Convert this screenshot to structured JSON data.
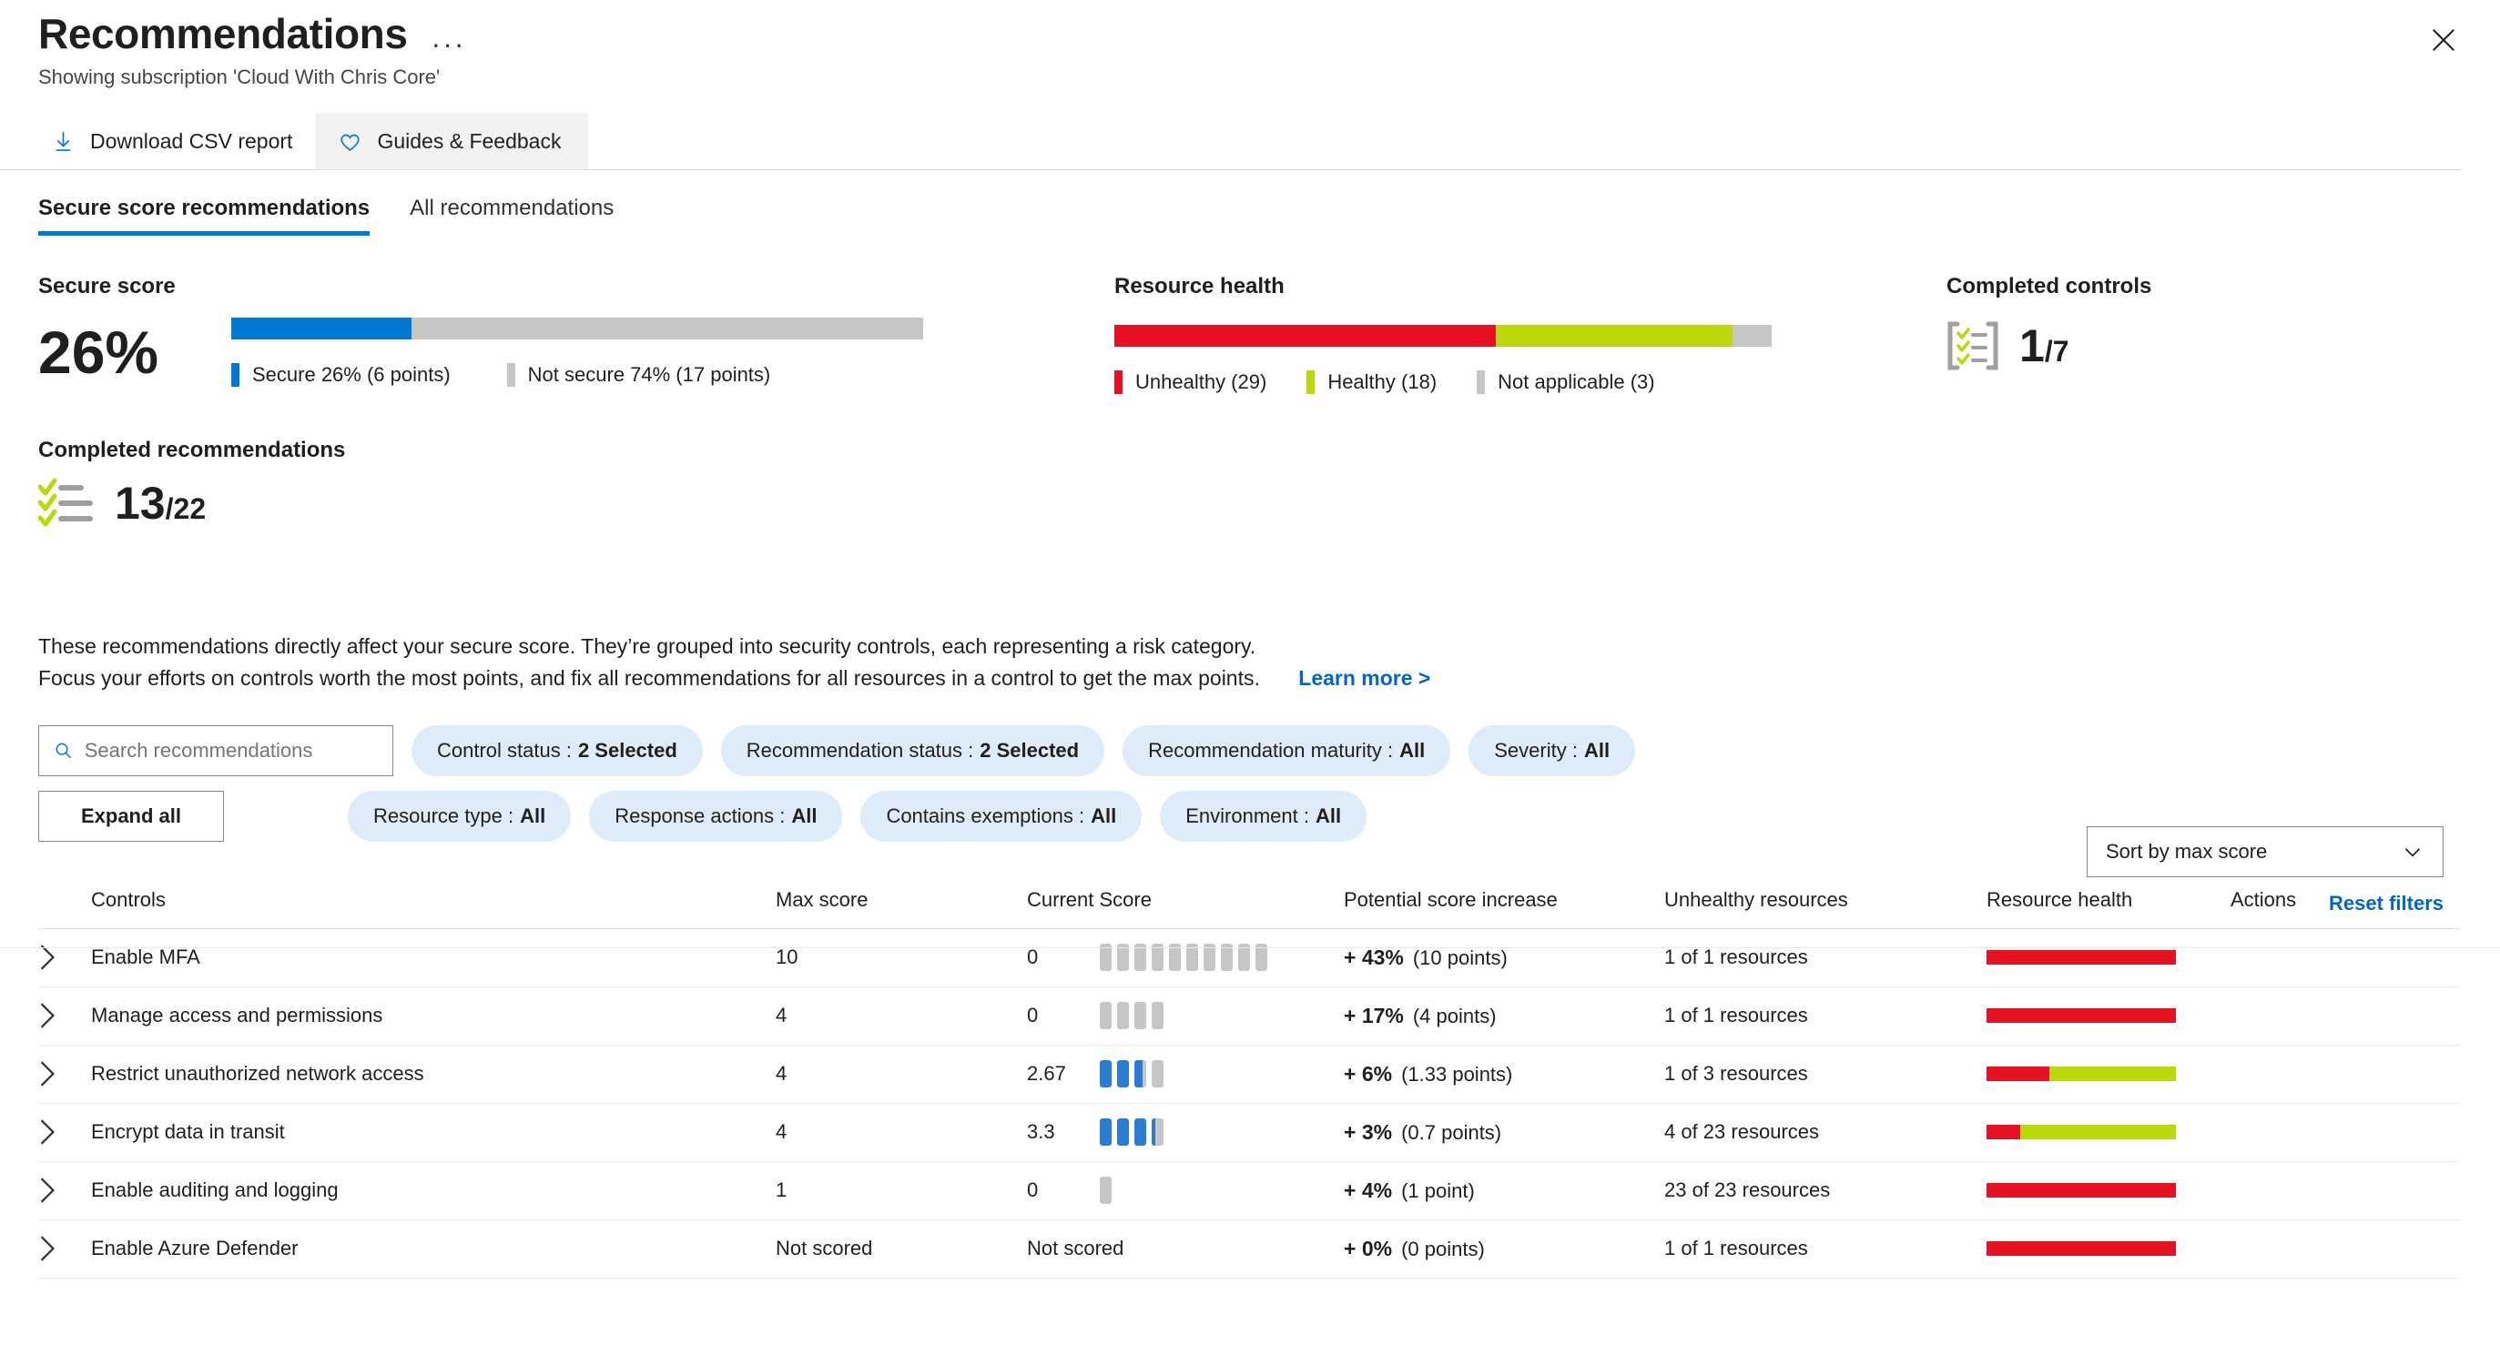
{
  "header": {
    "title": "Recommendations",
    "subtitle": "Showing subscription 'Cloud With Chris Core'",
    "more_label": "···",
    "close_label": ""
  },
  "commandbar": {
    "download_label": "Download CSV report",
    "feedback_label": "Guides & Feedback"
  },
  "tabs": [
    {
      "label": "Secure score recommendations",
      "active": true
    },
    {
      "label": "All recommendations",
      "active": false
    }
  ],
  "summary": {
    "secure_score": {
      "heading": "Secure score",
      "percent_text": "26%",
      "percent": 26,
      "secure_legend": "Secure 26% (6 points)",
      "not_secure_legend": "Not secure 74% (17 points)",
      "secure_color": "#0078d4",
      "not_secure_color": "#c8c6c4"
    },
    "completed_recommendations": {
      "heading": "Completed recommendations",
      "numerator": "13",
      "denominator": "/22"
    },
    "resource_health": {
      "heading": "Resource health",
      "segments": [
        {
          "label": "Unhealthy (29)",
          "value": 29,
          "color": "#e81123"
        },
        {
          "label": "Healthy (18)",
          "value": 18,
          "color": "#bad80a"
        },
        {
          "label": "Not applicable (3)",
          "value": 3,
          "color": "#c8c6c4"
        }
      ]
    },
    "completed_controls": {
      "heading": "Completed controls",
      "numerator": "1",
      "denominator": "/7"
    }
  },
  "description": {
    "line1": "These recommendations directly affect your secure score. They’re grouped into security controls, each representing a risk category.",
    "line2": "Focus your efforts on controls worth the most points, and fix all recommendations for all resources in a control to get the max points.",
    "learn_more": "Learn more >"
  },
  "filters": {
    "search_placeholder": "Search recommendations",
    "expand_all_label": "Expand all",
    "sort_label": "Sort by max score",
    "reset_label": "Reset filters",
    "row1": [
      {
        "name": "Control status",
        "value": "2 Selected"
      },
      {
        "name": "Recommendation status",
        "value": "2 Selected"
      },
      {
        "name": "Recommendation maturity",
        "value": "All"
      },
      {
        "name": "Severity",
        "value": "All"
      }
    ],
    "row2": [
      {
        "name": "Resource type",
        "value": "All"
      },
      {
        "name": "Response actions",
        "value": "All"
      },
      {
        "name": "Contains exemptions",
        "value": "All"
      },
      {
        "name": "Environment",
        "value": "All"
      }
    ]
  },
  "table": {
    "columns": [
      "Controls",
      "Max score",
      "Current Score",
      "Potential score increase",
      "Unhealthy resources",
      "Resource health",
      "Actions"
    ],
    "rows": [
      {
        "control": "Enable MFA",
        "max_score": "10",
        "max_segments": 10,
        "current_score": "0",
        "current_fill": 0,
        "potential_pct": "+ 43%",
        "potential_points": "(10 points)",
        "unhealthy_resources": "1 of 1 resources",
        "health": [
          {
            "color": "#e81123",
            "pct": 100
          }
        ]
      },
      {
        "control": "Manage access and permissions",
        "max_score": "4",
        "max_segments": 4,
        "current_score": "0",
        "current_fill": 0,
        "potential_pct": "+ 17%",
        "potential_points": "(4 points)",
        "unhealthy_resources": "1 of 1 resources",
        "health": [
          {
            "color": "#e81123",
            "pct": 100
          }
        ]
      },
      {
        "control": "Restrict unauthorized network access",
        "max_score": "4",
        "max_segments": 4,
        "current_score": "2.67",
        "current_fill": 2.67,
        "potential_pct": "+ 6%",
        "potential_points": "(1.33 points)",
        "unhealthy_resources": "1 of 3 resources",
        "health": [
          {
            "color": "#e81123",
            "pct": 33
          },
          {
            "color": "#bad80a",
            "pct": 67
          }
        ]
      },
      {
        "control": "Encrypt data in transit",
        "max_score": "4",
        "max_segments": 4,
        "current_score": "3.3",
        "current_fill": 3.3,
        "potential_pct": "+ 3%",
        "potential_points": "(0.7 points)",
        "unhealthy_resources": "4 of 23 resources",
        "health": [
          {
            "color": "#e81123",
            "pct": 18
          },
          {
            "color": "#bad80a",
            "pct": 82
          }
        ]
      },
      {
        "control": "Enable auditing and logging",
        "max_score": "1",
        "max_segments": 1,
        "current_score": "0",
        "current_fill": 0,
        "potential_pct": "+ 4%",
        "potential_points": "(1 point)",
        "unhealthy_resources": "23 of 23 resources",
        "health": [
          {
            "color": "#e81123",
            "pct": 100
          }
        ]
      },
      {
        "control": "Enable Azure Defender",
        "max_score": "Not scored",
        "max_segments": 0,
        "current_score": "Not scored",
        "current_fill": 0,
        "potential_pct": "+ 0%",
        "potential_points": "(0 points)",
        "unhealthy_resources": "1 of 1 resources",
        "health": [
          {
            "color": "#e81123",
            "pct": 100
          }
        ]
      }
    ]
  }
}
